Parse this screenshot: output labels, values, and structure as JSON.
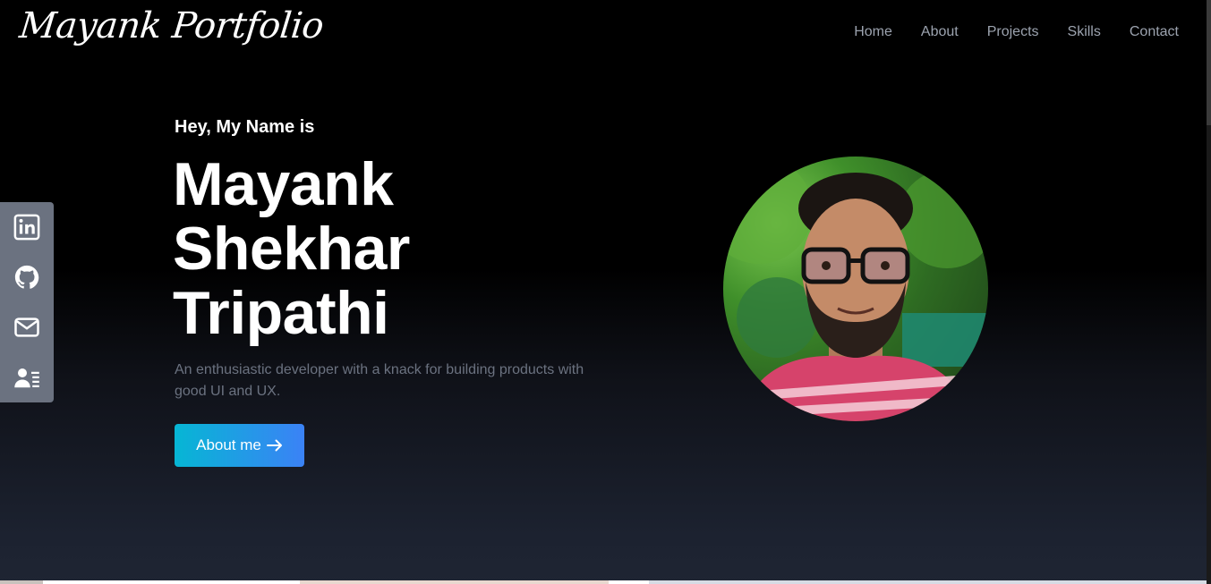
{
  "header": {
    "logo": "Mayank Portfolio",
    "nav": [
      "Home",
      "About",
      "Projects",
      "Skills",
      "Contact"
    ]
  },
  "social": {
    "icons": [
      "linkedin-icon",
      "github-icon",
      "mail-icon",
      "resume-icon"
    ]
  },
  "hero": {
    "greeting": "Hey, My Name is",
    "name_lines": [
      "Mayank",
      "Shekhar",
      "Tripathi"
    ],
    "tagline": "An enthusiastic developer with a knack for building products with good UI and UX.",
    "button_label": "About me",
    "button_icon": "arrow-right-icon"
  },
  "colors": {
    "background": "#000000",
    "nav_text": "#9ca3af",
    "sidebar": "#6b7280",
    "button_gradient_start": "#06b6d4",
    "button_gradient_end": "#3b82f6"
  }
}
